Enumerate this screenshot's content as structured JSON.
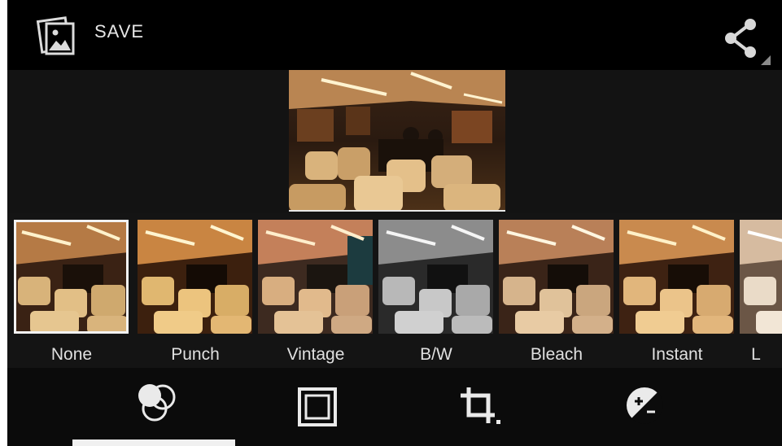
{
  "action_bar": {
    "save_label": "SAVE",
    "save_icon": "photo-save-icon",
    "share_icon": "share-icon"
  },
  "preview": {
    "description_icon": "train-interior-photo"
  },
  "filters": [
    {
      "label": "None",
      "selected": true,
      "tint": "#b78a4a"
    },
    {
      "label": "Punch",
      "selected": false,
      "tint": "#c99048"
    },
    {
      "label": "Vintage",
      "selected": false,
      "tint": "#a9763f"
    },
    {
      "label": "B/W",
      "selected": false,
      "tint": "#8a8a8a"
    },
    {
      "label": "Bleach",
      "selected": false,
      "tint": "#b68a60"
    },
    {
      "label": "Instant",
      "selected": false,
      "tint": "#c6884a"
    },
    {
      "label": "L",
      "selected": false,
      "tint": "#d0b49a"
    }
  ],
  "tools": [
    {
      "name": "filters",
      "icon": "filters-icon",
      "active": true
    },
    {
      "name": "borders",
      "icon": "border-frame-icon",
      "active": false
    },
    {
      "name": "crop",
      "icon": "crop-icon",
      "active": false
    },
    {
      "name": "exposure",
      "icon": "exposure-icon",
      "active": false
    }
  ],
  "colors": {
    "action_bar_bg": "#000000",
    "screen_bg": "#151515",
    "selection_outline": "#f2f2f2",
    "label_text": "#e0e0e0"
  }
}
